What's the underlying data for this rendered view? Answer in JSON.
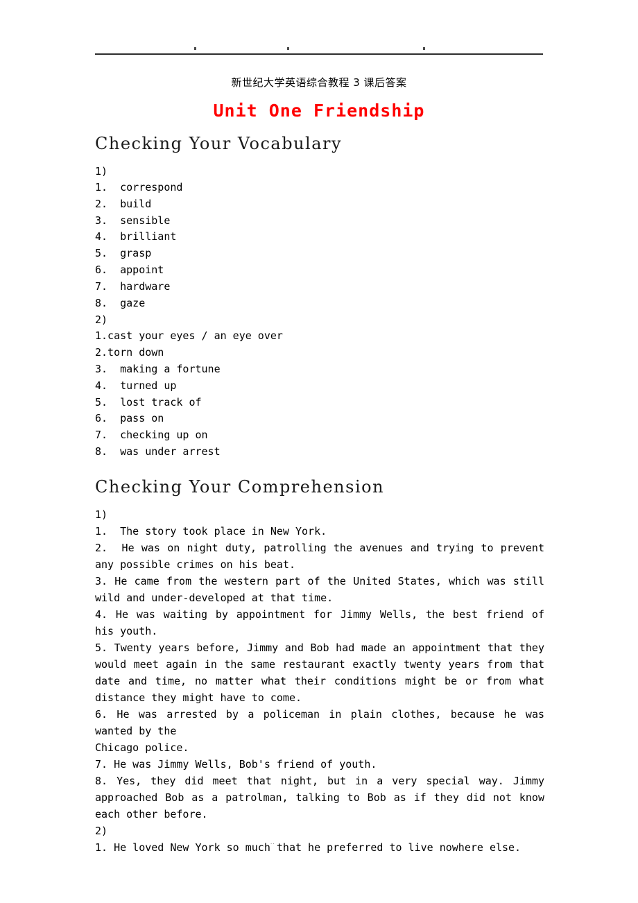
{
  "header": {
    "dots": [
      "·",
      "·",
      "·"
    ]
  },
  "document": {
    "subtitle": "新世纪大学英语综合教程 3 课后答案",
    "title": "Unit One Friendship",
    "title_color": "#ff0000"
  },
  "sections": [
    {
      "heading": "Checking Your Vocabulary",
      "groups": [
        {
          "label": "1)",
          "items": [
            "1.  correspond",
            "2.  build",
            "3.  sensible",
            "4.  brilliant",
            "5.  grasp",
            "6.  appoint",
            "7.  hardware",
            "8.  gaze"
          ]
        },
        {
          "label": "2)",
          "items": [
            "1.cast your eyes / an eye over",
            "2.torn down",
            "3.  making a fortune",
            "4.  turned up",
            "5.  lost track of",
            "6.  pass on",
            "7.  checking up on",
            "8.  was under arrest"
          ]
        }
      ]
    },
    {
      "heading": "Checking Your Comprehension",
      "groups": [
        {
          "label": "1)",
          "items": [
            "1.  The story took place in New York.",
            "2.  He was on night duty, patrolling the avenues and trying to prevent any possible crimes on his beat.",
            "3. He came from the western part of the United States, which was still wild and under-developed at that time.",
            "4. He was waiting by appointment for Jimmy Wells, the best friend of his youth.",
            "5. Twenty years before, Jimmy and Bob had made an appointment that they would meet again in the same restaurant exactly twenty years from that date and time, no matter what their conditions might be or from what distance they might have to come.",
            "6. He was arrested by a policeman in plain clothes, because he was wanted by the\nChicago police.",
            "7. He was Jimmy Wells, Bob's friend of youth.",
            "8. Yes, they did meet that night, but in a very special way. Jimmy approached Bob as a patrolman, talking to Bob as if they did not know each other before."
          ]
        },
        {
          "label": "2)",
          "items": [
            "1. He loved New York so much that he preferred to live nowhere else."
          ]
        }
      ]
    }
  ],
  "footer": {
    "left_mark": "··",
    "mid_mark": "··"
  }
}
